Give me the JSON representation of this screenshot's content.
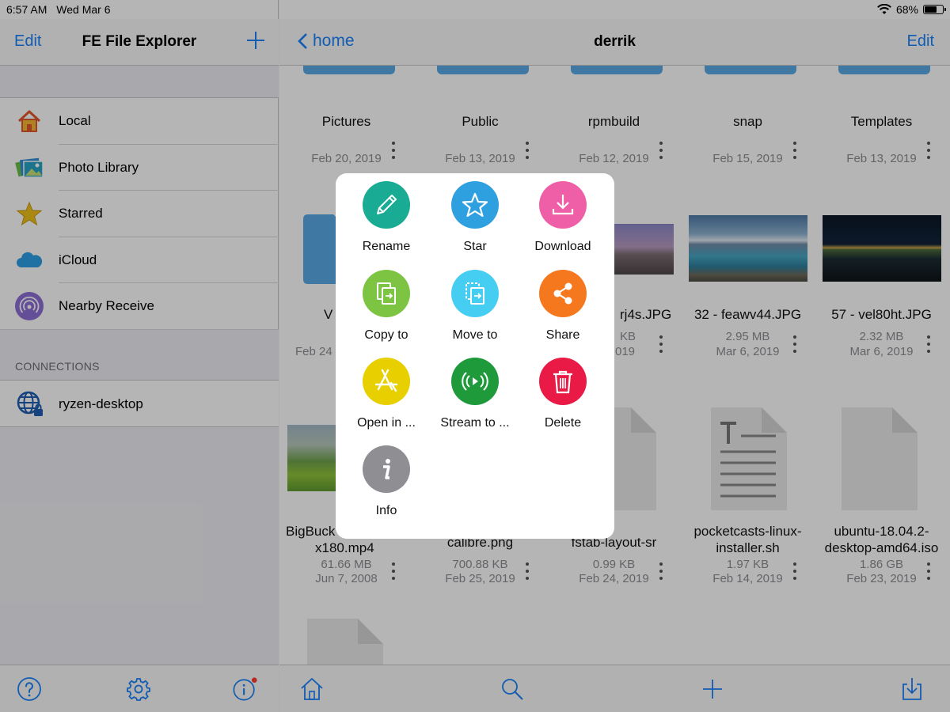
{
  "status": {
    "time": "6:57 AM",
    "date": "Wed Mar 6",
    "battery": "68%",
    "battery_level": 0.68
  },
  "sidebar": {
    "edit": "Edit",
    "title": "FE File Explorer",
    "items": [
      {
        "label": "Local",
        "icon": "home-icon"
      },
      {
        "label": "Photo Library",
        "icon": "photo-library-icon"
      },
      {
        "label": "Starred",
        "icon": "star-icon"
      },
      {
        "label": "iCloud",
        "icon": "cloud-icon"
      },
      {
        "label": "Nearby Receive",
        "icon": "nearby-receive-icon"
      }
    ],
    "connections_header": "CONNECTIONS",
    "connection": "ryzen-desktop"
  },
  "main": {
    "back": "home",
    "title": "derrik",
    "edit": "Edit",
    "rows": [
      [
        {
          "name": "Pictures",
          "date": "Feb 20, 2019"
        },
        {
          "name": "Public",
          "date": "Feb 13, 2019"
        },
        {
          "name": "rpmbuild",
          "date": "Feb 12, 2019"
        },
        {
          "name": "snap",
          "date": "Feb 15, 2019"
        },
        {
          "name": "Templates",
          "date": "Feb 13, 2019"
        }
      ],
      [
        {
          "name": "V",
          "date": "Feb 24"
        },
        {
          "name": "",
          "date": ""
        },
        {
          "name": "rj4s.JPG",
          "size": "KB",
          "date": "019"
        },
        {
          "name": "32 - feawv44.JPG",
          "size": "2.95 MB",
          "date": "Mar 6, 2019"
        },
        {
          "name": "57 - vel80ht.JPG",
          "size": "2.32 MB",
          "date": "Mar 6, 2019"
        }
      ],
      [
        {
          "name": "BigBuck",
          "name2": "x180.mp4",
          "size": "61.66 MB",
          "date": "Jun 7, 2008"
        },
        {
          "name": "calibre.png",
          "size": "700.88 KB",
          "date": "Feb 25, 2019"
        },
        {
          "name": "fstab-layout-sr",
          "size": "0.99 KB",
          "date": "Feb 24, 2019"
        },
        {
          "name": "pocketcasts-linux-",
          "name2": "installer.sh",
          "size": "1.97 KB",
          "date": "Feb 14, 2019"
        },
        {
          "name": "ubuntu-18.04.2-",
          "name2": "desktop-amd64.iso",
          "size": "1.86 GB",
          "date": "Feb 23, 2019"
        }
      ]
    ]
  },
  "actions": [
    {
      "label": "Rename",
      "icon": "pencil-icon",
      "color": "#1aab94"
    },
    {
      "label": "Star",
      "icon": "star-outline-icon",
      "color": "#2ea0e0"
    },
    {
      "label": "Download",
      "icon": "download-icon",
      "color": "#ee5fa7"
    },
    {
      "label": "Copy to",
      "icon": "copy-to-icon",
      "color": "#7dc443"
    },
    {
      "label": "Move to",
      "icon": "move-to-icon",
      "color": "#46cdf2"
    },
    {
      "label": "Share",
      "icon": "share-icon",
      "color": "#f5781f"
    },
    {
      "label": "Open in ...",
      "icon": "app-store-icon",
      "color": "#e8cf00"
    },
    {
      "label": "Stream to ...",
      "icon": "stream-icon",
      "color": "#1f9a3b"
    },
    {
      "label": "Delete",
      "icon": "trash-icon",
      "color": "#ea1a47"
    },
    {
      "label": "Info",
      "icon": "info-icon",
      "color": "#8e8e93"
    }
  ],
  "colors": {
    "accent": "#1a82fb",
    "folder": "#5aa9e6"
  }
}
